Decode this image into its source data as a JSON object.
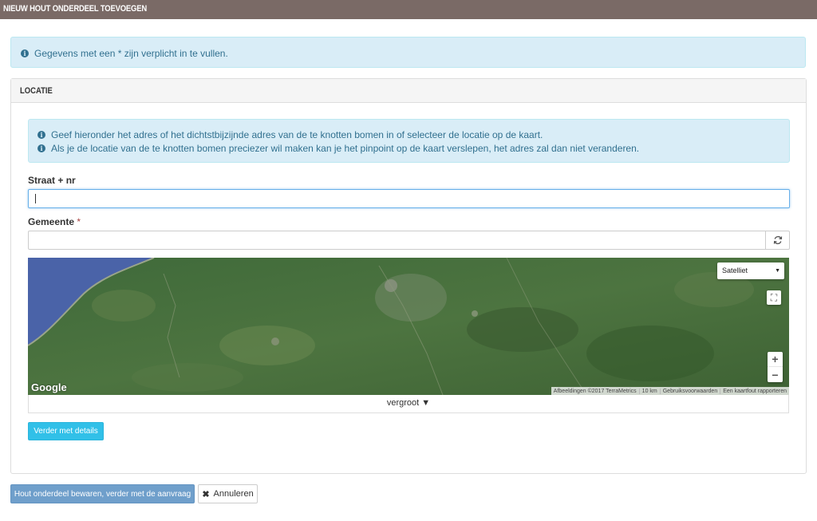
{
  "header": {
    "title": "NIEUW HOUT ONDERDEEL TOEVOEGEN"
  },
  "notice": {
    "text": "Gegevens met een * zijn verplicht in te vullen."
  },
  "panel": {
    "title": "LOCATIE",
    "info_lines": [
      "Geef hieronder het adres of het dichtstbijzijnde adres van de te knotten bomen in of selecteer de locatie op de kaart.",
      "Als je de locatie van de te knotten bomen preciezer wil maken kan je het pinpoint op de kaart verslepen, het adres zal dan niet veranderen."
    ],
    "street": {
      "label": "Straat + nr",
      "value": ""
    },
    "municipality": {
      "label": "Gemeente",
      "required_mark": "*",
      "value": ""
    },
    "map": {
      "type_selected": "Satelliet",
      "logo": "Google",
      "attribution": [
        "Afbeeldingen ©2017 TerraMetrics",
        "10 km",
        "Gebruiksvoorwaarden",
        "Een kaartfout rapporteren"
      ],
      "expand_label": "vergroot ▼"
    },
    "continue_button": "Verder met details"
  },
  "footer": {
    "save_button": "Hout onderdeel bewaren, verder met de aanvraag",
    "cancel_button": "Annuleren"
  },
  "colors": {
    "titlebar": "#7a6a66",
    "info": "#31708f",
    "button_info": "#31c0e8",
    "button_primary": "#6f9fcb"
  },
  "icons": {
    "info": "info-circle-icon",
    "refresh": "refresh-icon",
    "cancel": "close-icon",
    "fullscreen": "fullscreen-icon"
  }
}
